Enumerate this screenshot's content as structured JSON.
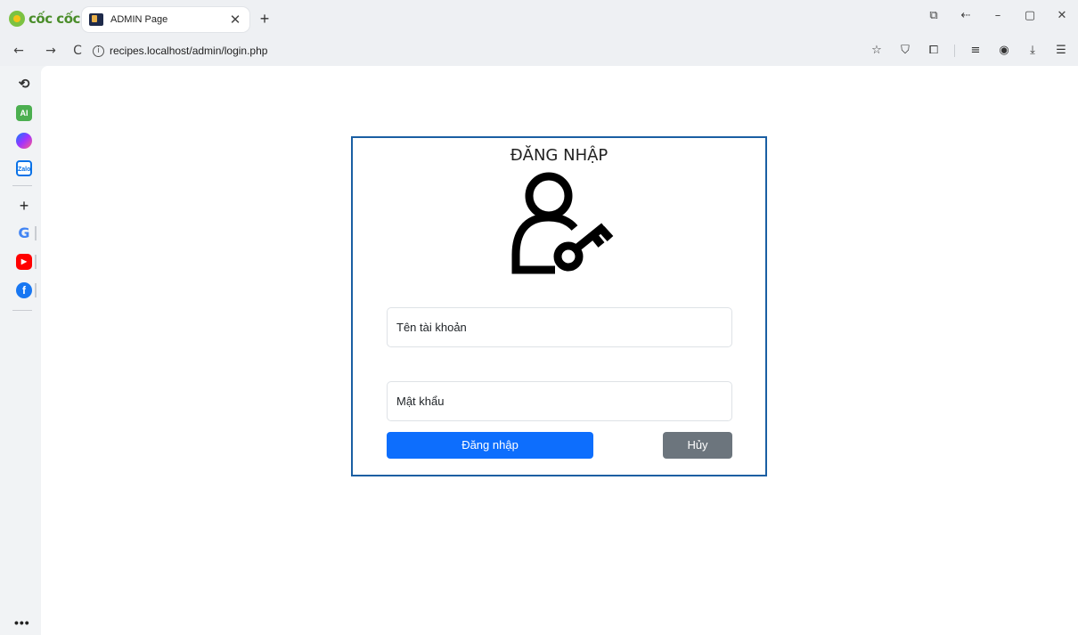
{
  "browser": {
    "brand": "cốc cốc",
    "tab_title": "ADMIN Page",
    "tab_close": "✕",
    "new_tab": "+",
    "url": "recipes.localhost/admin/login.php",
    "nav": {
      "back": "←",
      "forward": "→",
      "reload": "C"
    },
    "window_controls": {
      "minimize": "–",
      "restore": "▢",
      "close": "✕"
    }
  },
  "toolbar_icons": [
    "star-icon",
    "shield-icon",
    "extensions-icon",
    "reading-list-icon",
    "profile-icon",
    "download-icon",
    "menu-icon"
  ],
  "sidebar": {
    "items": [
      {
        "name": "history-icon",
        "glyph": "⟲"
      },
      {
        "name": "ai-icon",
        "glyph": "AI"
      },
      {
        "name": "messenger-icon",
        "glyph": ""
      },
      {
        "name": "zalo-icon",
        "glyph": "Zalo"
      },
      {
        "name": "add-icon",
        "glyph": "+"
      },
      {
        "name": "google-icon",
        "glyph": "G"
      },
      {
        "name": "youtube-icon",
        "glyph": "▶"
      },
      {
        "name": "facebook-icon",
        "glyph": "f"
      }
    ],
    "more": "•••"
  },
  "login": {
    "title": "ĐĂNG NHẬP",
    "username_placeholder": "Tên tài khoản",
    "password_placeholder": "Mật khẩu",
    "login_button": "Đăng nhập",
    "cancel_button": "Hủy"
  },
  "colors": {
    "card_border": "#1a5fa3",
    "primary": "#0d6efd",
    "secondary": "#6c757d"
  }
}
